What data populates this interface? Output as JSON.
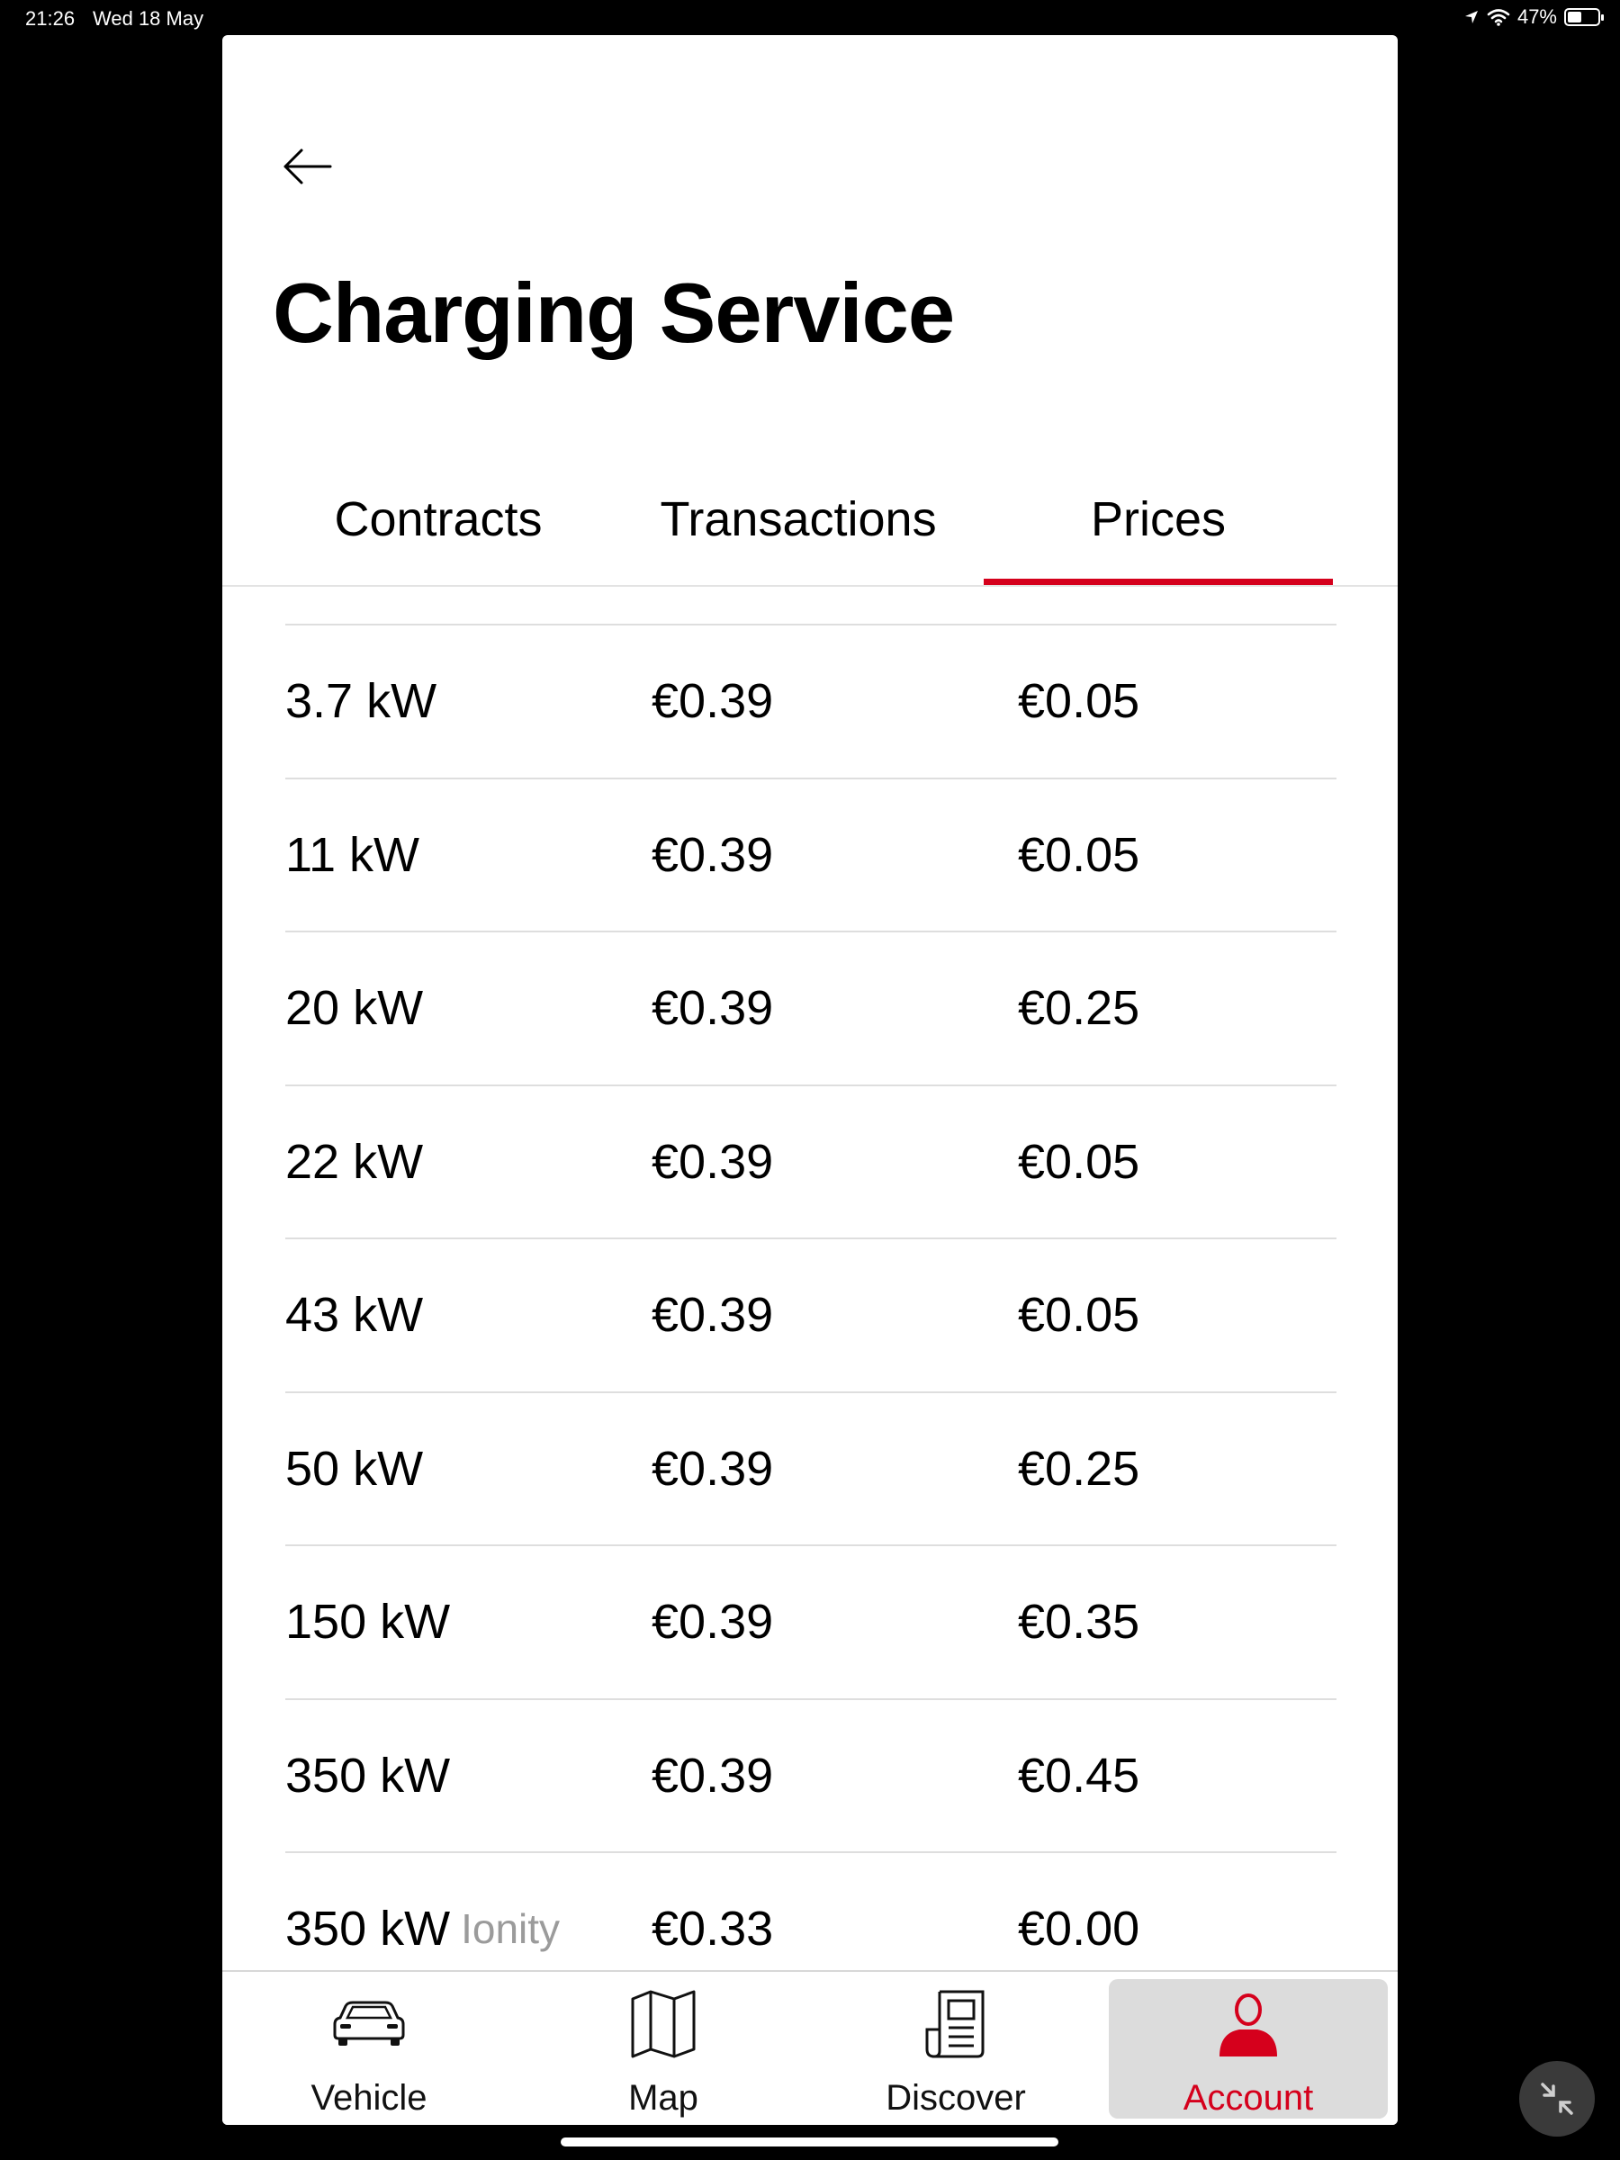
{
  "status_bar": {
    "time": "21:26",
    "date": "Wed 18 May",
    "battery": "47%",
    "battery_level": 0.47
  },
  "page": {
    "title": "Charging Service"
  },
  "tabs": [
    {
      "label": "Contracts",
      "active": false
    },
    {
      "label": "Transactions",
      "active": false
    },
    {
      "label": "Prices",
      "active": true
    }
  ],
  "prices": {
    "rows": [
      {
        "power": "3.7 kW",
        "tag": "",
        "col2": "€0.39",
        "col3": "€0.05"
      },
      {
        "power": "11 kW",
        "tag": "",
        "col2": "€0.39",
        "col3": "€0.05"
      },
      {
        "power": "20 kW",
        "tag": "",
        "col2": "€0.39",
        "col3": "€0.25"
      },
      {
        "power": "22 kW",
        "tag": "",
        "col2": "€0.39",
        "col3": "€0.05"
      },
      {
        "power": "43 kW",
        "tag": "",
        "col2": "€0.39",
        "col3": "€0.05"
      },
      {
        "power": "50 kW",
        "tag": "",
        "col2": "€0.39",
        "col3": "€0.25"
      },
      {
        "power": "150 kW",
        "tag": "",
        "col2": "€0.39",
        "col3": "€0.35"
      },
      {
        "power": "350 kW",
        "tag": "",
        "col2": "€0.39",
        "col3": "€0.45"
      },
      {
        "power": "350 kW",
        "tag": "Ionity",
        "col2": "€0.33",
        "col3": "€0.00"
      }
    ]
  },
  "bottom_nav": [
    {
      "label": "Vehicle",
      "icon": "car-icon",
      "active": false
    },
    {
      "label": "Map",
      "icon": "map-icon",
      "active": false
    },
    {
      "label": "Discover",
      "icon": "newspaper-icon",
      "active": false
    },
    {
      "label": "Account",
      "icon": "user-icon",
      "active": true
    }
  ],
  "colors": {
    "accent": "#d5001c",
    "active_nav_bg": "#dcdcdc"
  }
}
